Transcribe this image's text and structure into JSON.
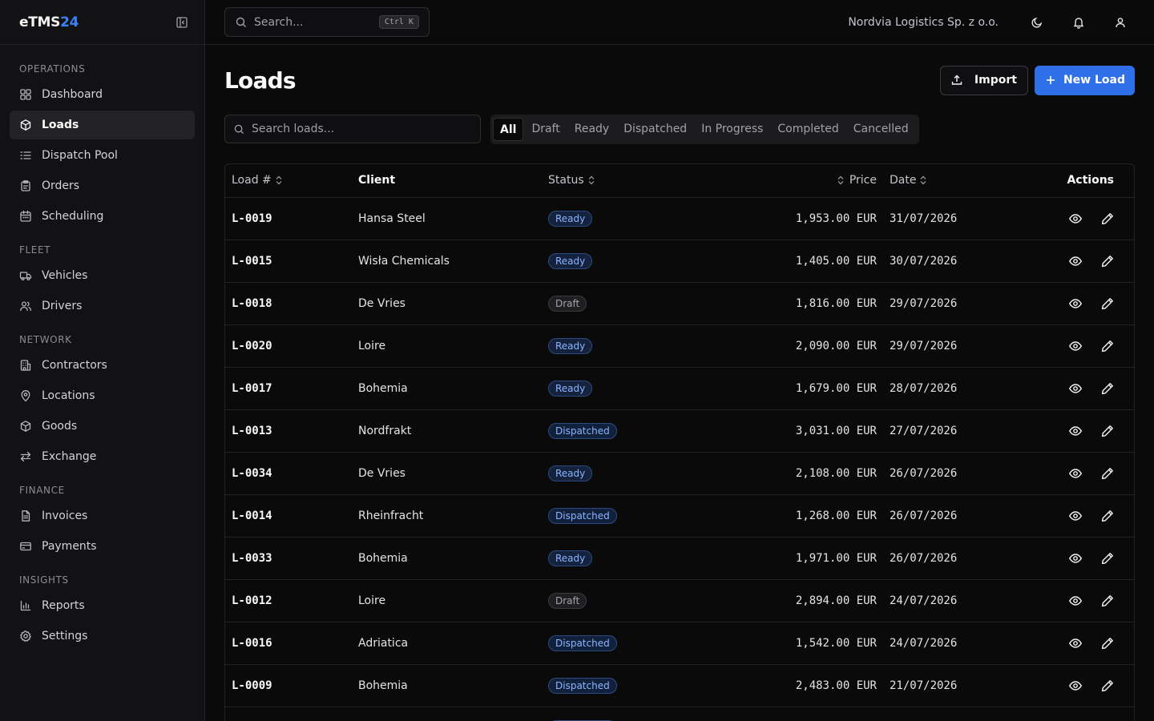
{
  "brand": {
    "prefix": "eTMS",
    "suffix": "24"
  },
  "nav": {
    "sections": [
      {
        "label": "OPERATIONS",
        "items": [
          {
            "label": "Dashboard",
            "icon": "dashboard-icon"
          },
          {
            "label": "Loads",
            "icon": "package-icon",
            "active": true
          },
          {
            "label": "Dispatch Pool",
            "icon": "list-icon"
          },
          {
            "label": "Orders",
            "icon": "clipboard-icon"
          },
          {
            "label": "Scheduling",
            "icon": "calendar-icon"
          }
        ]
      },
      {
        "label": "FLEET",
        "items": [
          {
            "label": "Vehicles",
            "icon": "truck-icon"
          },
          {
            "label": "Drivers",
            "icon": "users-icon"
          }
        ]
      },
      {
        "label": "NETWORK",
        "items": [
          {
            "label": "Contractors",
            "icon": "building-icon"
          },
          {
            "label": "Locations",
            "icon": "map-pin-icon"
          },
          {
            "label": "Goods",
            "icon": "package-icon"
          },
          {
            "label": "Exchange",
            "icon": "arrows-icon"
          }
        ]
      },
      {
        "label": "FINANCE",
        "items": [
          {
            "label": "Invoices",
            "icon": "file-icon"
          },
          {
            "label": "Payments",
            "icon": "credit-card-icon"
          }
        ]
      },
      {
        "label": "INSIGHTS",
        "items": [
          {
            "label": "Reports",
            "icon": "bar-chart-icon"
          },
          {
            "label": "Settings",
            "icon": "gear-icon"
          }
        ]
      }
    ]
  },
  "topbar": {
    "search_placeholder": "Search...",
    "shortcut": "Ctrl K",
    "company": "Nordvia Logistics Sp. z o.o."
  },
  "page": {
    "title": "Loads",
    "import_label": "Import",
    "new_label": "New Load",
    "search_placeholder": "Search loads...",
    "tabs": [
      "All",
      "Draft",
      "Ready",
      "Dispatched",
      "In Progress",
      "Completed",
      "Cancelled"
    ],
    "active_tab": "All"
  },
  "table": {
    "columns": {
      "load": "Load #",
      "client": "Client",
      "status": "Status",
      "price": "Price",
      "date": "Date",
      "actions": "Actions"
    },
    "rows": [
      {
        "load": "L-0019",
        "client": "Hansa Steel",
        "status": "Ready",
        "price": "1,953.00 EUR",
        "date": "31/07/2026"
      },
      {
        "load": "L-0015",
        "client": "Wisła Chemicals",
        "status": "Ready",
        "price": "1,405.00 EUR",
        "date": "30/07/2026"
      },
      {
        "load": "L-0018",
        "client": "De Vries",
        "status": "Draft",
        "price": "1,816.00 EUR",
        "date": "29/07/2026"
      },
      {
        "load": "L-0020",
        "client": "Loire",
        "status": "Ready",
        "price": "2,090.00 EUR",
        "date": "29/07/2026"
      },
      {
        "load": "L-0017",
        "client": "Bohemia",
        "status": "Ready",
        "price": "1,679.00 EUR",
        "date": "28/07/2026"
      },
      {
        "load": "L-0013",
        "client": "Nordfrakt",
        "status": "Dispatched",
        "price": "3,031.00 EUR",
        "date": "27/07/2026"
      },
      {
        "load": "L-0034",
        "client": "De Vries",
        "status": "Ready",
        "price": "2,108.00 EUR",
        "date": "26/07/2026"
      },
      {
        "load": "L-0014",
        "client": "Rheinfracht",
        "status": "Dispatched",
        "price": "1,268.00 EUR",
        "date": "26/07/2026"
      },
      {
        "load": "L-0033",
        "client": "Bohemia",
        "status": "Ready",
        "price": "1,971.00 EUR",
        "date": "26/07/2026"
      },
      {
        "load": "L-0012",
        "client": "Loire",
        "status": "Draft",
        "price": "2,894.00 EUR",
        "date": "24/07/2026"
      },
      {
        "load": "L-0016",
        "client": "Adriatica",
        "status": "Dispatched",
        "price": "1,542.00 EUR",
        "date": "24/07/2026"
      },
      {
        "load": "L-0009",
        "client": "Bohemia",
        "status": "Dispatched",
        "price": "2,483.00 EUR",
        "date": "21/07/2026"
      },
      {
        "load": "",
        "client": "",
        "status": "Dispatched",
        "price": "",
        "date": ""
      }
    ]
  }
}
